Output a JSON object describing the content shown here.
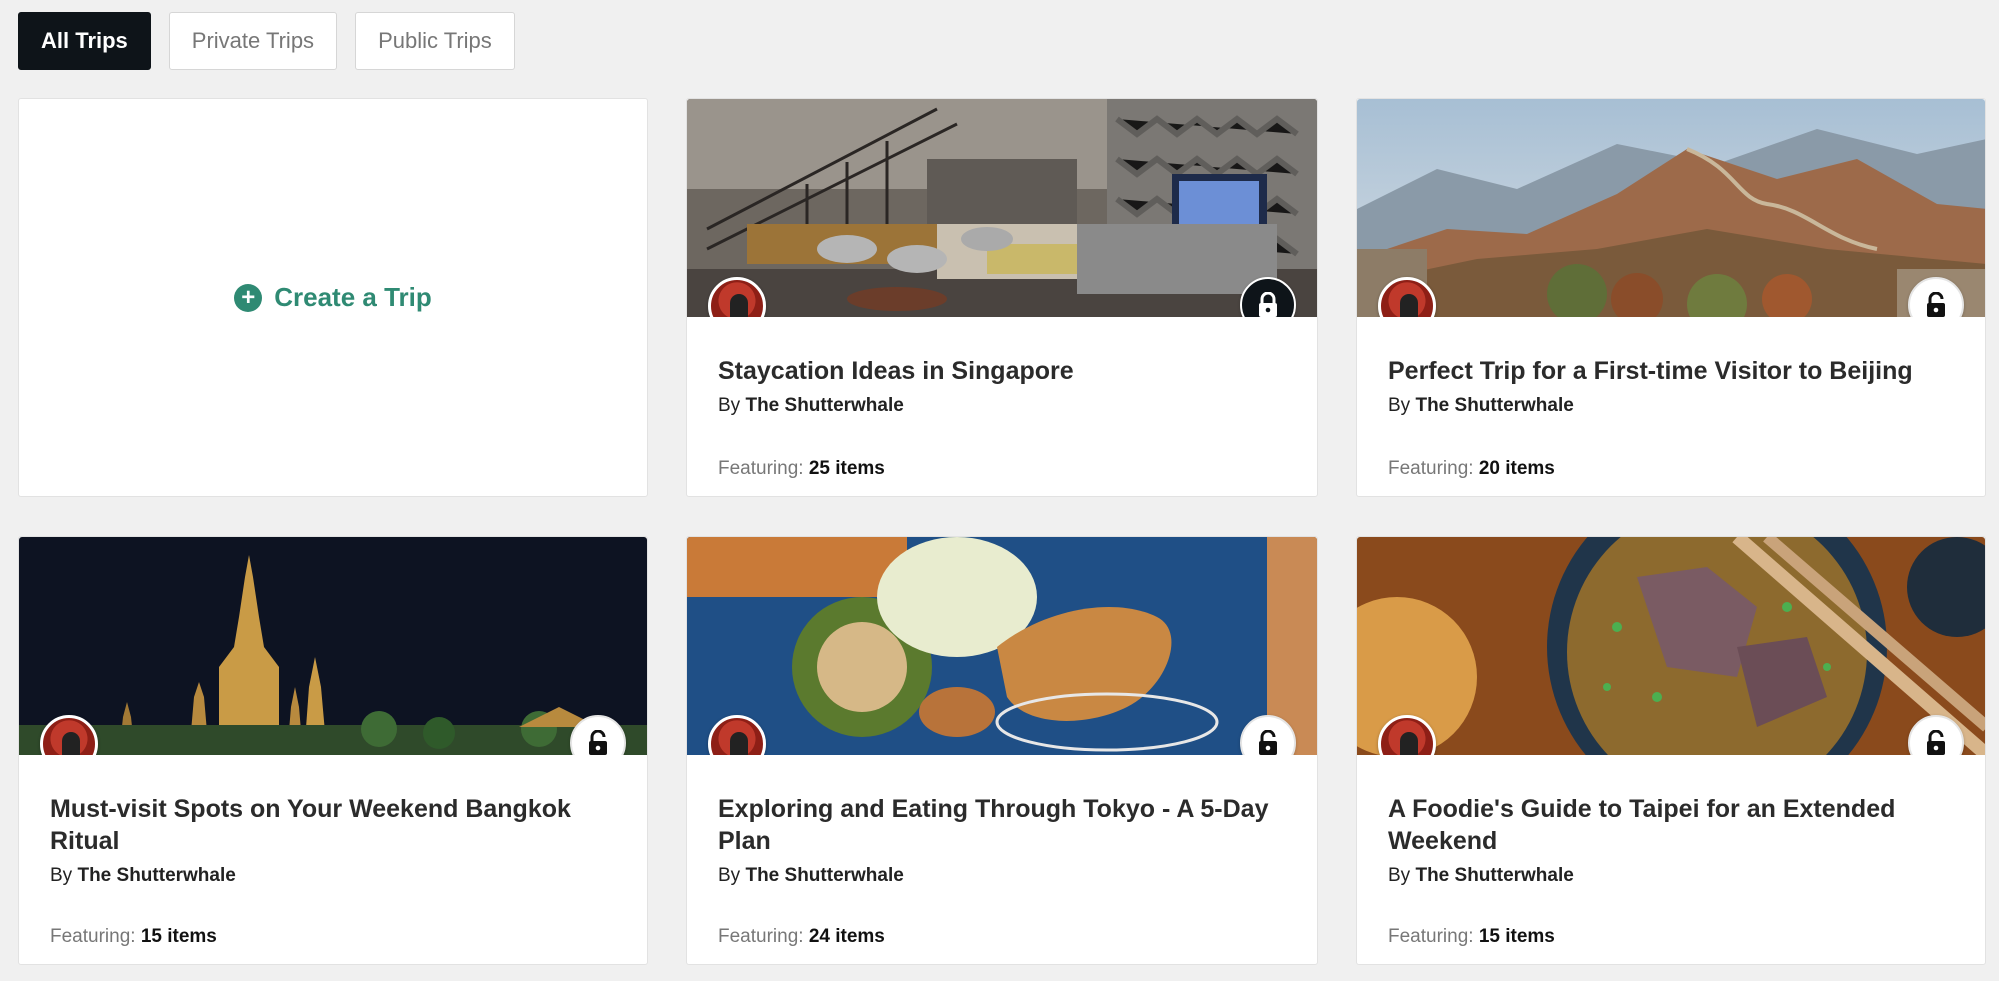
{
  "tabs": [
    {
      "label": "All Trips"
    },
    {
      "label": "Private Trips"
    },
    {
      "label": "Public Trips"
    }
  ],
  "create": {
    "label": "Create a Trip",
    "icon": "plus-circle-icon"
  },
  "by_prefix": "By",
  "featuring_prefix": "Featuring:",
  "trips": [
    {
      "title": "Staycation Ideas in Singapore",
      "author": "The Shutterwhale",
      "items": "25 items",
      "visibility": "private"
    },
    {
      "title": "Perfect Trip for a First-time Visitor to Beijing",
      "author": "The Shutterwhale",
      "items": "20 items",
      "visibility": "public"
    },
    {
      "title": "Must-visit Spots on Your Weekend Bangkok Ritual",
      "author": "The Shutterwhale",
      "items": "15 items",
      "visibility": "public"
    },
    {
      "title": "Exploring and Eating Through Tokyo - A 5-Day Plan",
      "author": "The Shutterwhale",
      "items": "24 items",
      "visibility": "public"
    },
    {
      "title": "A Foodie's Guide to Taipei for an Extended Weekend",
      "author": "The Shutterwhale",
      "items": "15 items",
      "visibility": "public"
    }
  ],
  "colors": {
    "accent": "#2f8a73",
    "active_tab": "#0e1419"
  }
}
